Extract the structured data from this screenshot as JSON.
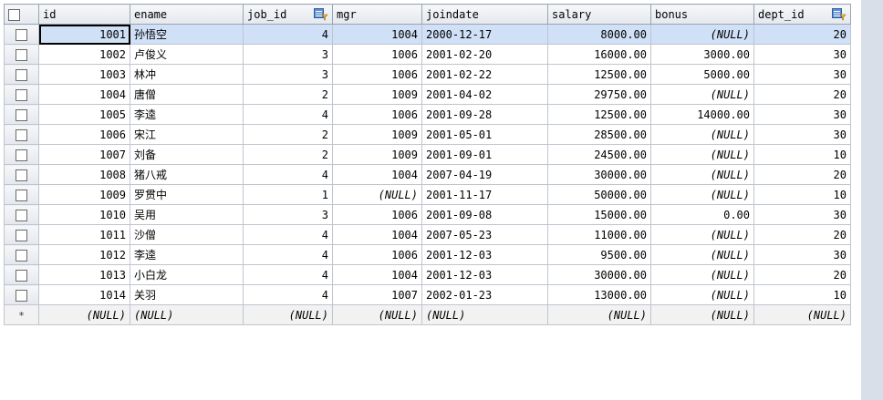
{
  "columns": [
    {
      "name": "id",
      "sorted": true,
      "filter": false
    },
    {
      "name": "ename",
      "sorted": false,
      "filter": false
    },
    {
      "name": "job_id",
      "sorted": false,
      "filter": true
    },
    {
      "name": "mgr",
      "sorted": false,
      "filter": false
    },
    {
      "name": "joindate",
      "sorted": false,
      "filter": false
    },
    {
      "name": "salary",
      "sorted": false,
      "filter": false
    },
    {
      "name": "bonus",
      "sorted": false,
      "filter": false
    },
    {
      "name": "dept_id",
      "sorted": false,
      "filter": true
    }
  ],
  "rows": [
    [
      "1001",
      "孙悟空",
      "4",
      "1004",
      "2000-12-17",
      "8000.00",
      "(NULL)",
      "20"
    ],
    [
      "1002",
      "卢俊义",
      "3",
      "1006",
      "2001-02-20",
      "16000.00",
      "3000.00",
      "30"
    ],
    [
      "1003",
      "林冲",
      "3",
      "1006",
      "2001-02-22",
      "12500.00",
      "5000.00",
      "30"
    ],
    [
      "1004",
      "唐僧",
      "2",
      "1009",
      "2001-04-02",
      "29750.00",
      "(NULL)",
      "20"
    ],
    [
      "1005",
      "李逵",
      "4",
      "1006",
      "2001-09-28",
      "12500.00",
      "14000.00",
      "30"
    ],
    [
      "1006",
      "宋江",
      "2",
      "1009",
      "2001-05-01",
      "28500.00",
      "(NULL)",
      "30"
    ],
    [
      "1007",
      "刘备",
      "2",
      "1009",
      "2001-09-01",
      "24500.00",
      "(NULL)",
      "10"
    ],
    [
      "1008",
      "猪八戒",
      "4",
      "1004",
      "2007-04-19",
      "30000.00",
      "(NULL)",
      "20"
    ],
    [
      "1009",
      "罗贯中",
      "1",
      "(NULL)",
      "2001-11-17",
      "50000.00",
      "(NULL)",
      "10"
    ],
    [
      "1010",
      "吴用",
      "3",
      "1006",
      "2001-09-08",
      "15000.00",
      "0.00",
      "30"
    ],
    [
      "1011",
      "沙僧",
      "4",
      "1004",
      "2007-05-23",
      "11000.00",
      "(NULL)",
      "20"
    ],
    [
      "1012",
      "李逵",
      "4",
      "1006",
      "2001-12-03",
      "9500.00",
      "(NULL)",
      "30"
    ],
    [
      "1013",
      "小白龙",
      "4",
      "1004",
      "2001-12-03",
      "30000.00",
      "(NULL)",
      "20"
    ],
    [
      "1014",
      "关羽",
      "4",
      "1007",
      "2002-01-23",
      "13000.00",
      "(NULL)",
      "10"
    ]
  ],
  "new_row": {
    "marker": "*",
    "values": [
      "(NULL)",
      "(NULL)",
      "(NULL)",
      "(NULL)",
      "(NULL)",
      "(NULL)",
      "(NULL)",
      "(NULL)"
    ]
  },
  "colors": {
    "selected_row": "#cfe0f7",
    "sorted_header": "#f9cf6a",
    "grid_line": "#bfc5cf"
  },
  "icons": {
    "filter": "filter-icon",
    "checkbox": "checkbox"
  }
}
